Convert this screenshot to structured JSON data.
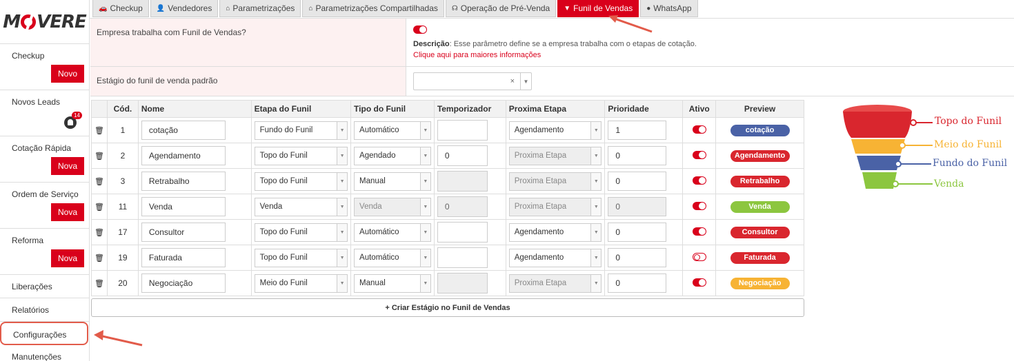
{
  "brand": {
    "logo_left": "M",
    "logo_right": "VERE"
  },
  "sidebar": {
    "items": [
      {
        "label": "Checkup",
        "badge": "Novo"
      },
      {
        "label": "Novos Leads",
        "notifications": "14"
      },
      {
        "label": "Cotação Rápida",
        "badge": "Nova"
      },
      {
        "label": "Ordem de Serviço",
        "badge": "Nova"
      },
      {
        "label": "Reforma",
        "badge": "Nova"
      },
      {
        "label": "Liberações"
      },
      {
        "label": "Relatórios"
      },
      {
        "label": "Configurações",
        "selected": true
      },
      {
        "label": "Manutenções"
      }
    ]
  },
  "tabs": [
    {
      "label": "Checkup",
      "icon": "car-icon"
    },
    {
      "label": "Vendedores",
      "icon": "user-icon"
    },
    {
      "label": "Parametrizações",
      "icon": "settings-icon"
    },
    {
      "label": "Parametrizações Compartilhadas",
      "icon": "settings-icon"
    },
    {
      "label": "Operação de Pré-Venda",
      "icon": "headset-icon"
    },
    {
      "label": "Funil de Vendas",
      "icon": "filter-icon",
      "active": true
    },
    {
      "label": "WhatsApp",
      "icon": "chat-icon"
    }
  ],
  "params": {
    "funnel_enabled": {
      "label": "Empresa trabalha com Funil de Vendas?",
      "enabled": true,
      "desc_title": "Descrição",
      "desc_text": ": Esse parâmetro define se a empresa trabalha com o etapas de cotação.",
      "link": "Clique aqui para maiores informações"
    },
    "default_stage": {
      "label": "Estágio do funil de venda padrão",
      "value": "",
      "clear": "×"
    }
  },
  "table": {
    "headers": [
      "Cód.",
      "Nome",
      "Etapa do Funil",
      "Tipo do Funil",
      "Temporizador",
      "Proxima Etapa",
      "Prioridade",
      "Ativo",
      "Preview"
    ],
    "rows": [
      {
        "code": "1",
        "name": "cotação",
        "stage": "Fundo do Funil",
        "type": "Automático",
        "timer": "",
        "timer_disabled": false,
        "next": "Agendamento",
        "next_disabled": false,
        "priority": "1",
        "priority_disabled": false,
        "active": true,
        "preview": "cotação",
        "color": "#4a62a6"
      },
      {
        "code": "2",
        "name": "Agendamento",
        "stage": "Topo do Funil",
        "type": "Agendado",
        "timer": "0",
        "timer_disabled": false,
        "next": "Proxima Etapa",
        "next_disabled": true,
        "priority": "0",
        "priority_disabled": false,
        "active": true,
        "preview": "Agendamento",
        "color": "#d9262e"
      },
      {
        "code": "3",
        "name": "Retrabalho",
        "stage": "Topo do Funil",
        "type": "Manual",
        "timer": "",
        "timer_disabled": true,
        "next": "Proxima Etapa",
        "next_disabled": true,
        "priority": "0",
        "priority_disabled": false,
        "active": true,
        "preview": "Retrabalho",
        "color": "#d9262e"
      },
      {
        "code": "11",
        "name": "Venda",
        "stage": "Venda",
        "type": "Venda",
        "type_disabled": true,
        "timer": "0",
        "timer_disabled": true,
        "next": "Proxima Etapa",
        "next_disabled": true,
        "priority": "0",
        "priority_disabled": true,
        "active": true,
        "preview": "Venda",
        "color": "#8cc63f"
      },
      {
        "code": "17",
        "name": "Consultor",
        "stage": "Topo do Funil",
        "type": "Automático",
        "timer": "",
        "timer_disabled": false,
        "next": "Agendamento",
        "next_disabled": false,
        "priority": "0",
        "priority_disabled": false,
        "active": true,
        "preview": "Consultor",
        "color": "#d9262e"
      },
      {
        "code": "19",
        "name": "Faturada",
        "stage": "Topo do Funil",
        "type": "Automático",
        "timer": "",
        "timer_disabled": false,
        "next": "Agendamento",
        "next_disabled": false,
        "priority": "0",
        "priority_disabled": false,
        "active": false,
        "preview": "Faturada",
        "color": "#d9262e"
      },
      {
        "code": "20",
        "name": "Negociação",
        "stage": "Meio do Funil",
        "type": "Manual",
        "timer": "",
        "timer_disabled": true,
        "next": "Proxima Etapa",
        "next_disabled": true,
        "priority": "0",
        "priority_disabled": false,
        "active": true,
        "preview": "Negociação",
        "color": "#f7b334"
      }
    ],
    "create_label": "+ Criar Estágio no Funil de Vendas"
  },
  "funnel_legend": [
    {
      "label": "Topo do Funil",
      "color": "#d9262e"
    },
    {
      "label": "Meio do Funil",
      "color": "#f7b334"
    },
    {
      "label": "Fundo do Funil",
      "color": "#4a62a6"
    },
    {
      "label": "Venda",
      "color": "#8cc63f"
    }
  ],
  "colors": {
    "accent": "#d9001b",
    "annotation_arrow": "#e25b4a"
  }
}
